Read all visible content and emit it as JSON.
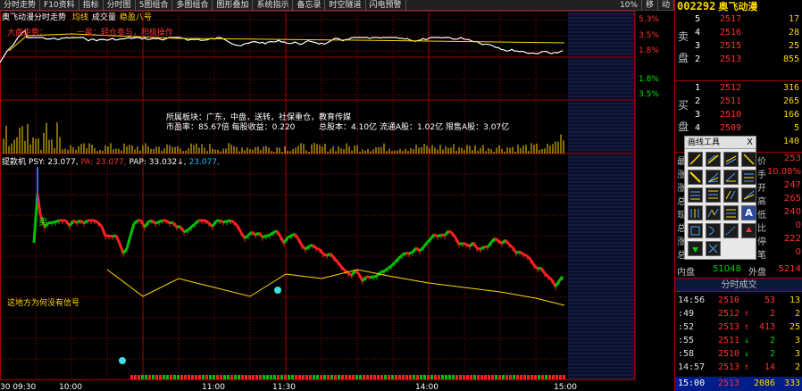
{
  "toolbar": {
    "items": [
      "分时走势",
      "F10资料",
      "指标",
      "分时图",
      "5图组合",
      "多图组合",
      "图形叠加",
      "系统指示",
      "备忘录",
      "时空隧道",
      "闪电预警"
    ],
    "zoom": "10%",
    "zoom_items": [
      "移",
      "动"
    ]
  },
  "chart": {
    "title": "奥飞动漫分时走势",
    "title_tags": [
      "均线",
      "成交量",
      "稳盈八号"
    ],
    "annotation_top": "大盘走势：",
    "annotation_red": "一星：轻仓参与，积极操作",
    "info_line1": "所属板块：广东，中盘，送转，社保重仓，教育传媒",
    "info_line2a": "市盈率：85.67倍  每股收益：0.220",
    "info_line2b": "总股本：4.10亿  流通A股：1.02亿  限售A股：3.07亿",
    "indicator_label": "提款机",
    "indicator_psy": "PSY: 23.077,",
    "indicator_pa": "PA: 23.077,",
    "indicator_pap": "PAP: 33.032↓,",
    "indicator_last": "23.077,",
    "no_signal_note": "这地方为何没有信号",
    "sell_mark": "卖",
    "right_axis_pct": [
      "5.3%",
      "3.5%",
      "1.8%",
      "1.8%",
      "3.5%"
    ],
    "time_labels": [
      "30 09:30",
      "10:00",
      "11:00",
      "11:30",
      "14:00",
      "15:00"
    ]
  },
  "stock": {
    "code": "002292",
    "name": "奥飞动漫"
  },
  "order_book": {
    "sell": [
      {
        "level": "5",
        "price": "2517",
        "vol": "17"
      },
      {
        "level": "4",
        "price": "2516",
        "vol": "28"
      },
      {
        "level": "3",
        "price": "2515",
        "vol": "25"
      },
      {
        "level": "2",
        "price": "2513",
        "vol": "855"
      }
    ],
    "buy": [
      {
        "level": "1",
        "price": "2512",
        "vol": "316"
      },
      {
        "level": "2",
        "price": "2511",
        "vol": "265"
      },
      {
        "level": "3",
        "price": "2510",
        "vol": "166"
      },
      {
        "level": "4",
        "price": "2509",
        "vol": "5"
      },
      {
        "level": "5",
        "price": "",
        "vol": "140"
      }
    ],
    "sell_label": "卖盘",
    "buy_label": "买盘"
  },
  "quote": {
    "rows": [
      {
        "l": "最",
        "r_label": "价",
        "r_val": "253"
      },
      {
        "l": "涨",
        "r_label": "手",
        "r_val": "10.08%"
      },
      {
        "l": "涨",
        "r_label": "开",
        "r_val": "247"
      },
      {
        "l": "总",
        "r_label": "高",
        "r_val": "265"
      },
      {
        "l": "现",
        "r_label": "低",
        "r_val": "240"
      },
      {
        "l": "总",
        "r_label": "比",
        "r_val": "0"
      },
      {
        "l": "涨",
        "r_label": "停",
        "r_val": "222"
      },
      {
        "l": "总",
        "r_label": "笔",
        "r_val": "0"
      }
    ],
    "inner_label": "内盘",
    "inner_val": "51048",
    "outer_label": "外盘",
    "outer_val": "5214"
  },
  "ticks": {
    "title": "分时成交",
    "rows": [
      {
        "time": "14:56",
        "price": "2510",
        "vol": "53",
        "num": "13",
        "dir": ""
      },
      {
        "time": ":49",
        "price": "2512",
        "vol": "2",
        "num": "2",
        "dir": "↑"
      },
      {
        "time": ":52",
        "price": "2513",
        "vol": "413",
        "num": "25",
        "dir": "↑"
      },
      {
        "time": ":55",
        "price": "2511",
        "vol": "2",
        "num": "3",
        "dir": "↓"
      },
      {
        "time": ":58",
        "price": "2510",
        "vol": "2",
        "num": "3",
        "dir": "↓"
      },
      {
        "time": "14:57",
        "price": "2513",
        "vol": "14",
        "num": "2",
        "dir": "↑"
      }
    ],
    "bottom": {
      "time": "15:00",
      "price": "2513",
      "vol": "2086",
      "num": "333"
    }
  },
  "palette": {
    "title": "画线工具",
    "close": "X",
    "tools": [
      "line-tool-icon",
      "ray-tool-icon",
      "channel-tool-icon",
      "segment-tool-icon",
      "diagonal-tool-icon",
      "fan-tool-icon",
      "angle-tool-icon",
      "parallel-tool-icon",
      "hline-tool-icon",
      "fib-tool-icon",
      "gann-tool-icon",
      "speed-tool-icon",
      "cycle-tool-icon",
      "wave-tool-icon",
      "arrow-tool-icon",
      "text-tool-icon",
      "rect-tool-icon",
      "arc-tool-icon",
      "pen-tool-icon",
      "uparrow-tool-icon",
      "downarrow-tool-icon",
      "cross-tool-icon"
    ],
    "text_tool_label": "A"
  },
  "colors": {
    "price_line": "#ffffff",
    "avg_line": "#ffd800",
    "up": "#ff2020",
    "down": "#00c000",
    "grid": "#a00000",
    "accent": "#ffd800"
  }
}
